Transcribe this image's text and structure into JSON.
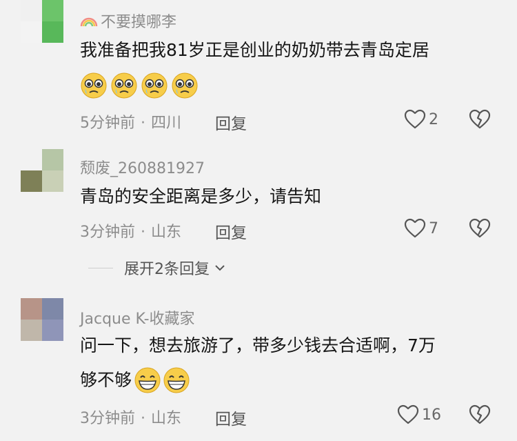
{
  "comments": [
    {
      "username": "不要摸哪李",
      "text": "我准备把我81岁正是创业的奶奶带去青岛定居",
      "emojis": [
        "pleading-face-icon",
        "pleading-face-icon",
        "pleading-face-icon",
        "pleading-face-icon"
      ],
      "time": "5分钟前",
      "location": "四川",
      "reply_label": "回复",
      "likes": "2",
      "avatar_colors": [
        "#f0f0f0",
        "#6cc46a",
        "#f2f2f2",
        "#58b85a"
      ]
    },
    {
      "username": "颓废_260881927",
      "text": "青岛的安全距离是多少，请告知",
      "time": "3分钟前",
      "location": "山东",
      "reply_label": "回复",
      "likes": "7",
      "avatar_colors": [
        "#f2f2f2",
        "#b6c6a6",
        "#7e8057",
        "#c9d0b6"
      ]
    },
    {
      "username": "Jacque K-收藏家",
      "text_line1": "问一下，想去旅游了，带多少钱去合适啊，7万",
      "text_line2": "够不够",
      "emojis": [
        "grinning-face-icon",
        "grinning-face-icon"
      ],
      "time": "3分钟前",
      "location": "山东",
      "reply_label": "回复",
      "likes": "16",
      "avatar_colors": [
        "#b79488",
        "#7e88a8",
        "#c0b7aa",
        "#8f95b8"
      ]
    }
  ],
  "expand_replies": "展开2条回复",
  "colors": {
    "background": "#f2f2f2",
    "text_primary": "#161616",
    "text_secondary": "#8c8c8c"
  }
}
